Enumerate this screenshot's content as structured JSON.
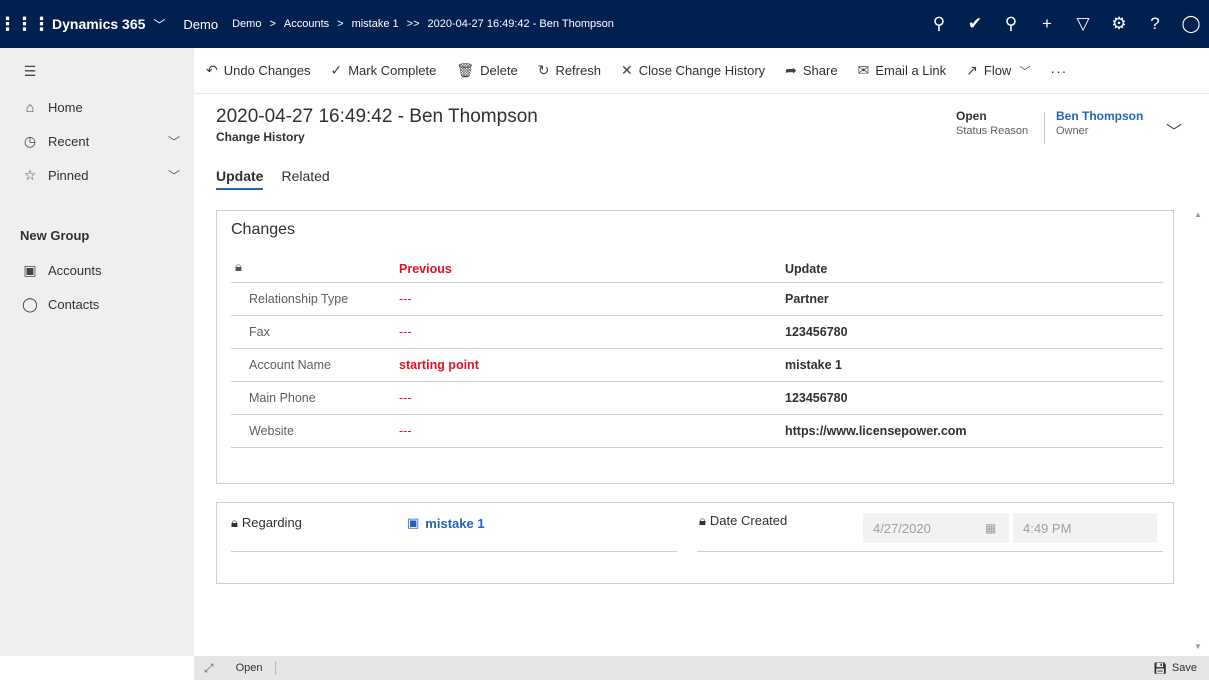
{
  "topbar": {
    "app_name": "Dynamics 365",
    "env_name": "Demo",
    "breadcrumb": [
      "Demo",
      "Accounts",
      "mistake 1",
      "2020-04-27 16:49:42 - Ben Thompson"
    ],
    "icons": [
      "search-icon",
      "task-icon",
      "lightbulb-icon",
      "plus-icon",
      "filter-icon",
      "gear-icon",
      "help-icon",
      "user-icon"
    ]
  },
  "nav": {
    "home": "Home",
    "recent": "Recent",
    "pinned": "Pinned",
    "group_title": "New Group",
    "accounts": "Accounts",
    "contacts": "Contacts"
  },
  "commands": {
    "undo": "Undo Changes",
    "mark_complete": "Mark Complete",
    "delete": "Delete",
    "refresh": "Refresh",
    "close_history": "Close Change History",
    "share": "Share",
    "email_link": "Email a Link",
    "flow": "Flow",
    "more": "···"
  },
  "record": {
    "title": "2020-04-27 16:49:42 - Ben Thompson",
    "entity": "Change History",
    "status_value": "Open",
    "status_label": "Status Reason",
    "owner_value": "Ben Thompson",
    "owner_label": "Owner"
  },
  "tabs": [
    "Update",
    "Related"
  ],
  "changes": {
    "title": "Changes",
    "col_previous": "Previous",
    "col_update": "Update",
    "rows": [
      {
        "field": "Relationship Type",
        "previous": "---",
        "update": "Partner"
      },
      {
        "field": "Fax",
        "previous": "---",
        "update": "123456780"
      },
      {
        "field": "Account Name",
        "previous": "starting point",
        "update": "mistake 1"
      },
      {
        "field": "Main Phone",
        "previous": "---",
        "update": "123456780"
      },
      {
        "field": "Website",
        "previous": "---",
        "update": "https://www.licensepower.com"
      }
    ]
  },
  "details": {
    "regarding_label": "Regarding",
    "regarding_value": "mistake 1",
    "date_created_label": "Date Created",
    "date_value": "4/27/2020",
    "time_value": "4:49 PM"
  },
  "statusbar": {
    "status": "Open",
    "save": "Save"
  },
  "colors": {
    "topbar_bg": "#002050",
    "accent": "#2266b8",
    "previous_red": "#e81123"
  }
}
